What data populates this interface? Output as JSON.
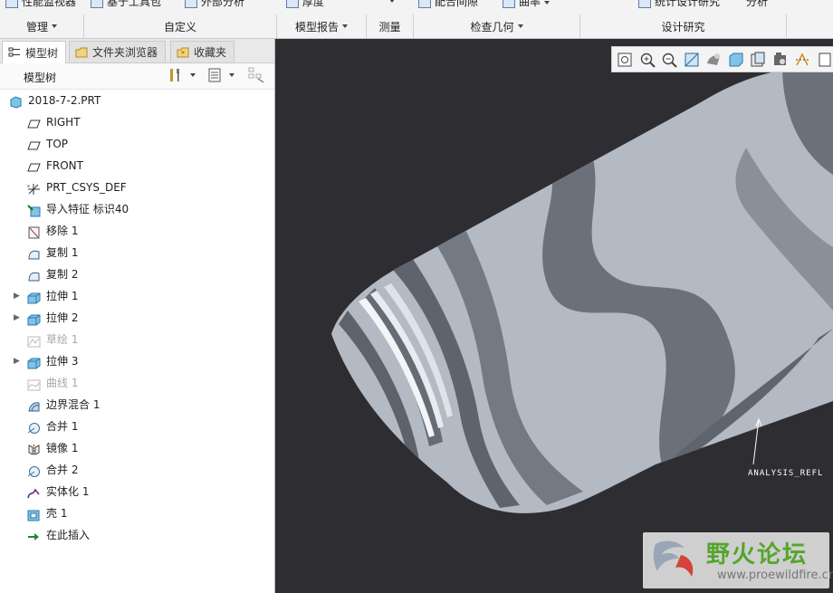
{
  "ribbon": {
    "top_cut": [
      {
        "label": "性能监视器"
      },
      {
        "label": "基于工具包"
      },
      {
        "label": "外部分析"
      },
      {
        "label": "厚度"
      },
      {
        "label": "配合间隙"
      },
      {
        "label": "曲率"
      },
      {
        "label": "统计设计研究"
      },
      {
        "label": "分析"
      }
    ],
    "groups": [
      {
        "label": "管理",
        "dropdown": true
      },
      {
        "label": "自定义",
        "dropdown": false
      },
      {
        "label": "模型报告",
        "dropdown": true
      },
      {
        "label": "测量",
        "dropdown": false
      },
      {
        "label": "检查几何",
        "dropdown": true
      },
      {
        "label": "设计研究",
        "dropdown": false
      }
    ]
  },
  "left_panel": {
    "tabs": [
      {
        "label": "模型树",
        "active": true,
        "icon": "model-tree-icon"
      },
      {
        "label": "文件夹浏览器",
        "active": false,
        "icon": "folder-browser-icon"
      },
      {
        "label": "收藏夹",
        "active": false,
        "icon": "favorites-icon"
      }
    ],
    "tree_title": "模型树",
    "tree": [
      {
        "label": "2018-7-2.PRT",
        "icon": "part-icon",
        "level": 0,
        "expandable": false,
        "suppressed": false
      },
      {
        "label": "RIGHT",
        "icon": "datum-plane-icon",
        "level": 1,
        "expandable": false,
        "suppressed": false
      },
      {
        "label": "TOP",
        "icon": "datum-plane-icon",
        "level": 1,
        "expandable": false,
        "suppressed": false
      },
      {
        "label": "FRONT",
        "icon": "datum-plane-icon",
        "level": 1,
        "expandable": false,
        "suppressed": false
      },
      {
        "label": "PRT_CSYS_DEF",
        "icon": "csys-icon",
        "level": 1,
        "expandable": false,
        "suppressed": false
      },
      {
        "label": "导入特征 标识40",
        "icon": "import-feature-icon",
        "level": 1,
        "expandable": false,
        "suppressed": false
      },
      {
        "label": "移除 1",
        "icon": "remove-icon",
        "level": 1,
        "expandable": false,
        "suppressed": false
      },
      {
        "label": "复制 1",
        "icon": "copy-surface-icon",
        "level": 1,
        "expandable": false,
        "suppressed": false
      },
      {
        "label": "复制 2",
        "icon": "copy-surface-icon",
        "level": 1,
        "expandable": false,
        "suppressed": false
      },
      {
        "label": "拉伸 1",
        "icon": "extrude-icon",
        "level": 1,
        "expandable": true,
        "suppressed": false
      },
      {
        "label": "拉伸 2",
        "icon": "extrude-icon",
        "level": 1,
        "expandable": true,
        "suppressed": false
      },
      {
        "label": "草绘 1",
        "icon": "sketch-icon",
        "level": 1,
        "expandable": false,
        "suppressed": true
      },
      {
        "label": "拉伸 3",
        "icon": "extrude-icon",
        "level": 1,
        "expandable": true,
        "suppressed": false
      },
      {
        "label": "曲线 1",
        "icon": "curve-icon",
        "level": 1,
        "expandable": false,
        "suppressed": true
      },
      {
        "label": "边界混合 1",
        "icon": "boundary-blend-icon",
        "level": 1,
        "expandable": false,
        "suppressed": false
      },
      {
        "label": "合并 1",
        "icon": "merge-icon",
        "level": 1,
        "expandable": false,
        "suppressed": false
      },
      {
        "label": "镜像 1",
        "icon": "mirror-icon",
        "level": 1,
        "expandable": false,
        "suppressed": false
      },
      {
        "label": "合并 2",
        "icon": "merge-icon",
        "level": 1,
        "expandable": false,
        "suppressed": false
      },
      {
        "label": "实体化 1",
        "icon": "solidify-icon",
        "level": 1,
        "expandable": false,
        "suppressed": false
      },
      {
        "label": "壳 1",
        "icon": "shell-icon",
        "level": 1,
        "expandable": false,
        "suppressed": false
      },
      {
        "label": "在此插入",
        "icon": "insert-here-icon",
        "level": 1,
        "expandable": false,
        "suppressed": false
      }
    ]
  },
  "viewport": {
    "toolbar_icons": [
      "zoom-fit-icon",
      "zoom-in-icon",
      "zoom-out-icon",
      "reorient-icon",
      "shading-icon",
      "display-style-icon",
      "saved-views-icon",
      "view-manager-icon",
      "datum-display-icon",
      "more-icon"
    ],
    "annotation": "ANALYSIS_REFL",
    "watermark": {
      "title": "野火论坛",
      "url": "www.proewildfire.cn"
    },
    "colors": {
      "background": "#2e2e32",
      "light_band": "#b4bac4",
      "dark_band": "#6b717b"
    }
  }
}
